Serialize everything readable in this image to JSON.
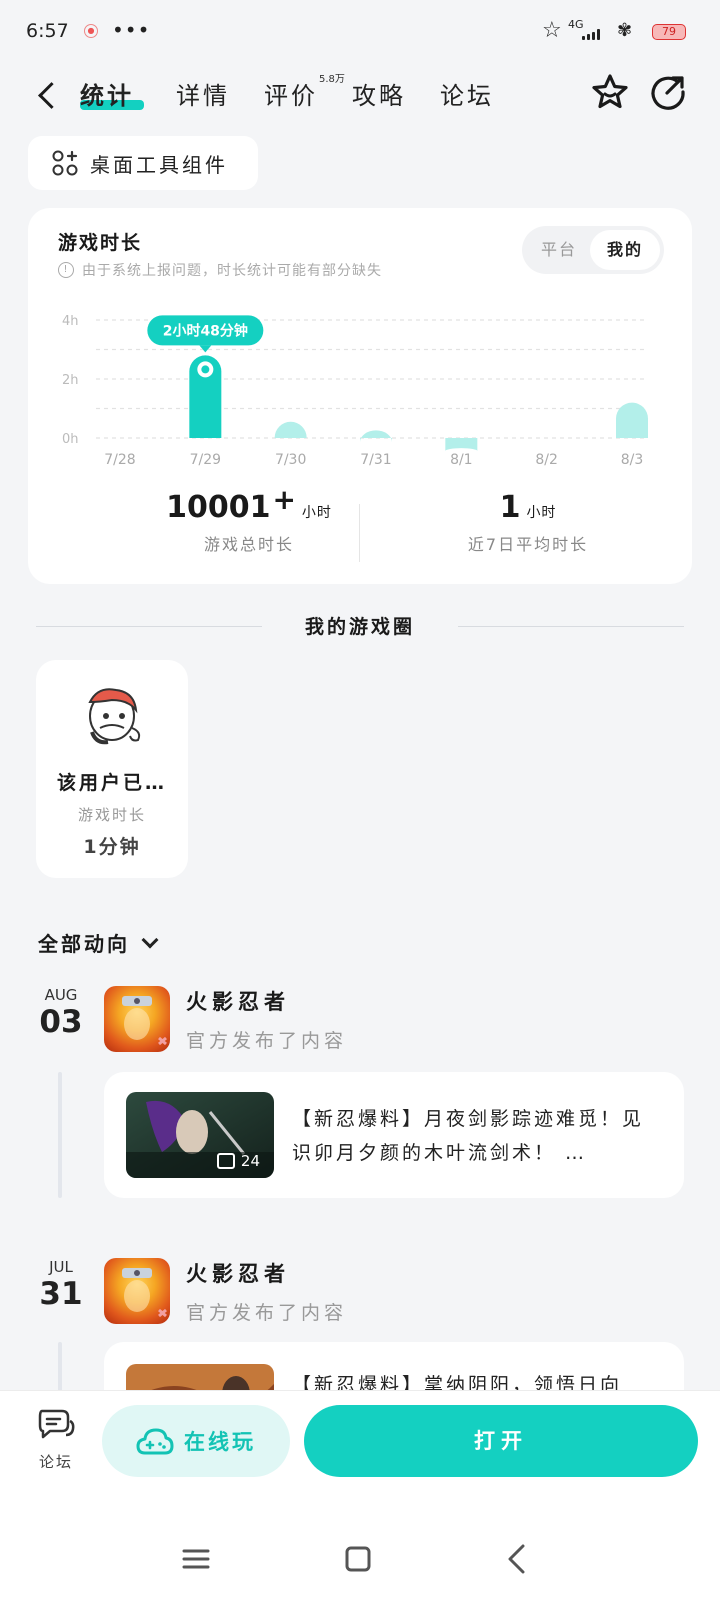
{
  "status_bar": {
    "time": "6:57",
    "signal_label": "4G",
    "battery": "79"
  },
  "nav": {
    "tabs": [
      {
        "label": "统计",
        "active": true
      },
      {
        "label": "详情"
      },
      {
        "label": "评价"
      },
      {
        "label": "攻略"
      },
      {
        "label": "论坛"
      }
    ],
    "review_badge": "5.8万"
  },
  "widget_button": {
    "label": "桌面工具组件"
  },
  "stats": {
    "title": "游戏时长",
    "note": "由于系统上报问题，时长统计可能有部分缺失",
    "segment": {
      "options": [
        "平台",
        "我的"
      ],
      "selected": "我的"
    },
    "total": {
      "value": "10001",
      "plus": "+",
      "unit": "小时",
      "label": "游戏总时长"
    },
    "average": {
      "value": "1",
      "unit": "小时",
      "label": "近7日平均时长"
    }
  },
  "chart_data": {
    "type": "bar",
    "categories": [
      "7/28",
      "7/29",
      "7/30",
      "7/31",
      "8/1",
      "8/2",
      "8/3"
    ],
    "values": [
      0,
      2.8,
      0.55,
      0.4,
      0.1,
      0,
      1.2
    ],
    "y_unit": "h",
    "y_ticks": [
      "4h",
      "2h",
      "0h"
    ],
    "ylim": [
      0,
      4
    ],
    "highlight_index": 1,
    "tooltip": "2小时48分钟",
    "colors": {
      "highlight": "#14d0c1",
      "normal": "#b3efea"
    },
    "grid": "dashed"
  },
  "circle": {
    "title": "我的游戏圈",
    "user": {
      "name": "该用户已…",
      "label": "游戏时长",
      "value": "1分钟"
    }
  },
  "feed": {
    "filter_label": "全部动向",
    "items": [
      {
        "month": "AUG",
        "day": "03",
        "game": "火影忍者",
        "subtitle": "官方发布了内容",
        "post_text": "【新忍爆料】月夜剑影踪迹难觅！见识卯月夕颜的木叶流剑术！ …",
        "image_count": "24"
      },
      {
        "month": "JUL",
        "day": "31",
        "game": "火影忍者",
        "subtitle": "官方发布了内容",
        "post_text": "【新忍爆料】掌纳阴阳，领悟日向"
      }
    ]
  },
  "bottom_bar": {
    "forum_label": "论坛",
    "play_label": "在线玩",
    "open_label": "打开"
  },
  "colors": {
    "accent": "#14d0c1",
    "accent_light": "#e0f7f5"
  }
}
